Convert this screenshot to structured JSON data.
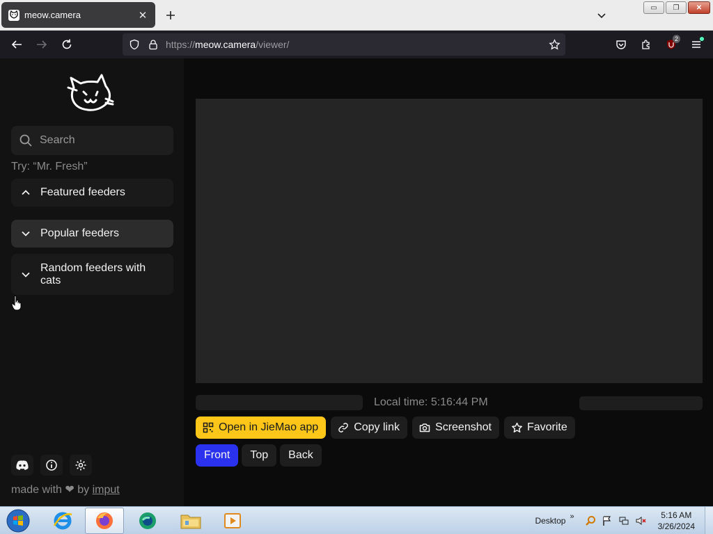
{
  "browser": {
    "tab_title": "meow.camera",
    "tab_close": "✕",
    "url_base": "https://",
    "url_domain": "meow.camera",
    "url_path": "/viewer/",
    "extension_badge": "2"
  },
  "window_controls": {
    "minimize": "▭",
    "maximize": "❐",
    "close": "✕"
  },
  "sidebar": {
    "search_placeholder": "Search",
    "try_hint": "Try: “Mr. Fresh”",
    "sections": [
      {
        "label": "Featured feeders",
        "state": "expanded"
      },
      {
        "label": "Popular feeders",
        "state": "collapsed"
      },
      {
        "label": "Random feeders with cats",
        "state": "collapsed"
      }
    ],
    "footer": {
      "made_with_prefix": "made with",
      "heart": "❤",
      "by": "by",
      "author": "imput"
    }
  },
  "main": {
    "local_time": "Local time: 5:16:44 PM",
    "buttons": {
      "open_app": "Open in JieMao app",
      "copy_link": "Copy link",
      "screenshot": "Screenshot",
      "favorite": "Favorite"
    },
    "views": [
      {
        "label": "Front",
        "active": true
      },
      {
        "label": "Top",
        "active": false
      },
      {
        "label": "Back",
        "active": false
      }
    ]
  },
  "taskbar": {
    "apps": [
      "start",
      "internet-explorer",
      "firefox",
      "edge-app",
      "file-explorer",
      "media-player"
    ],
    "desktop_label": "Desktop",
    "overflow": "»",
    "time": "5:16 AM",
    "date": "3/26/2024"
  },
  "colors": {
    "accent_yellow": "#ffc61a",
    "active_view": "#2a32f0",
    "page_bg": "#0b0b0b",
    "sidebar_bg": "#121212"
  }
}
